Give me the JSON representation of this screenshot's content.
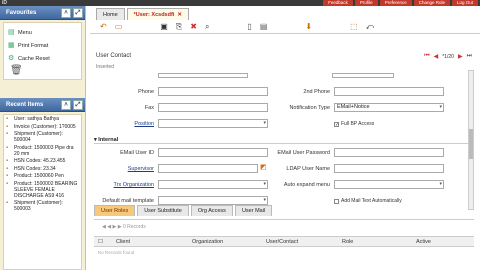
{
  "app": {
    "logo_text": "iD"
  },
  "top_links": [
    "Feedback",
    "Profile",
    "Preference",
    "Change Role",
    "Log Out"
  ],
  "favourites": {
    "title": "Favourites",
    "items": [
      {
        "label": "Menu",
        "icon": "menu-icon"
      },
      {
        "label": "Print Format",
        "icon": "print-format-icon"
      },
      {
        "label": "Cache Reset",
        "icon": "cache-reset-icon"
      }
    ]
  },
  "recent": {
    "title": "Recent Items",
    "items": [
      "User: sathya Bathya",
      "Invoice (Customer): 1?0005",
      "Shipment (Customer): 500004",
      "Product: 1500003 Pipe dra 20 mm",
      "HSN Codes: 45.23.455",
      "HSN Codes: 23.34",
      "Product: 1500060 Pen",
      "Product: 1500002 BEARING SLEEVE FEMALE DISCHARGE AS9 416",
      "Shipment (Customer): 500003"
    ]
  },
  "tabs": [
    {
      "label": "Home",
      "active": false
    },
    {
      "label": "*User: Xcsdsdfi",
      "active": true
    }
  ],
  "window": {
    "title": "User Contact",
    "record": "*1/20",
    "inserted_label": "Inserted"
  },
  "form": {
    "phone_label": "Phone",
    "phone2_label": "2nd Phone",
    "fax_label": "Fax",
    "notification_label": "Notification Type",
    "notification_value": "EMail+Notice",
    "position_label": "Position",
    "full_bp_access": "Full BP Access",
    "internal_section": "Internal",
    "email_user_id_label": "EMail User ID",
    "email_user_password_label": "EMail User Password",
    "supervisor_label": "Supervisor",
    "ldap_label": "LDAP User Name",
    "trx_org_label": "Trx Organization",
    "auto_expand_label": "Auto expand menu",
    "default_mail_label": "Default mail template",
    "add_mail_text": "Add Mail Text Automatically"
  },
  "detail_tabs": [
    {
      "label": "User Roles",
      "active": true
    },
    {
      "label": "User Substitute",
      "active": false
    },
    {
      "label": "Org Access",
      "active": false
    },
    {
      "label": "User Mail",
      "active": false
    }
  ],
  "grid": {
    "records_label": "0 Records",
    "columns": [
      "Client",
      "Organization",
      "User/Contact",
      "Role",
      "Active"
    ],
    "empty_label": "No Records found"
  }
}
